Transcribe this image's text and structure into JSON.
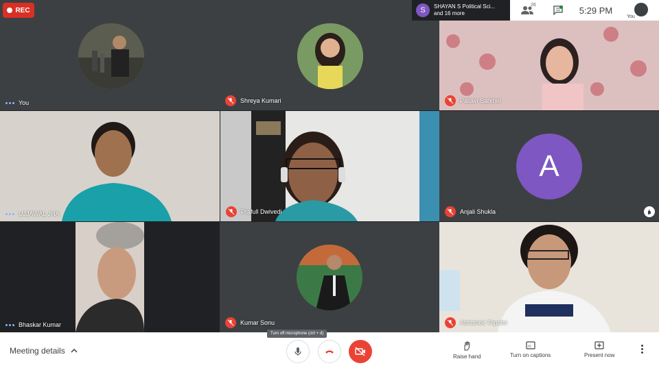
{
  "recording": {
    "label": "REC"
  },
  "topbar": {
    "presenter_initial": "S",
    "presenter_name": "SHAYAN S Political Sci...",
    "presenter_more": "and 16 more",
    "people_count": "26",
    "time": "5:29 PM",
    "self_label": "You"
  },
  "participants": [
    {
      "name": "You",
      "muted": false
    },
    {
      "name": "Shreya Kumari",
      "muted": true
    },
    {
      "name": "Pallavi Sarkhel",
      "muted": true
    },
    {
      "name": "UJJAWAL JHA",
      "muted": false
    },
    {
      "name": "Prafull Dwivedi",
      "muted": true
    },
    {
      "name": "Anjali Shukla",
      "muted": true,
      "initial": "A"
    },
    {
      "name": "Bhaskar Kumar",
      "muted": false
    },
    {
      "name": "Kumar Sonu",
      "muted": true
    },
    {
      "name": "Abhishek Tripathi",
      "muted": true
    }
  ],
  "bottombar": {
    "meeting_details": "Meeting details",
    "mic_tooltip": "Turn off microphone (ctrl + d)",
    "raise_hand": "Raise hand",
    "captions": "Turn on captions",
    "present": "Present now"
  },
  "colors": {
    "accent_red": "#ea4335",
    "anjali_avatar": "#7e57c2",
    "presenter_avatar": "#7e57c2",
    "background": "#202124"
  },
  "icons": [
    "record-dot-icon",
    "people-icon",
    "chat-icon",
    "mic-muted-icon",
    "mic-icon",
    "hangup-icon",
    "camera-off-icon",
    "raise-hand-icon",
    "captions-icon",
    "present-icon",
    "more-vert-icon",
    "chevron-up-icon",
    "audio-level-icon"
  ]
}
